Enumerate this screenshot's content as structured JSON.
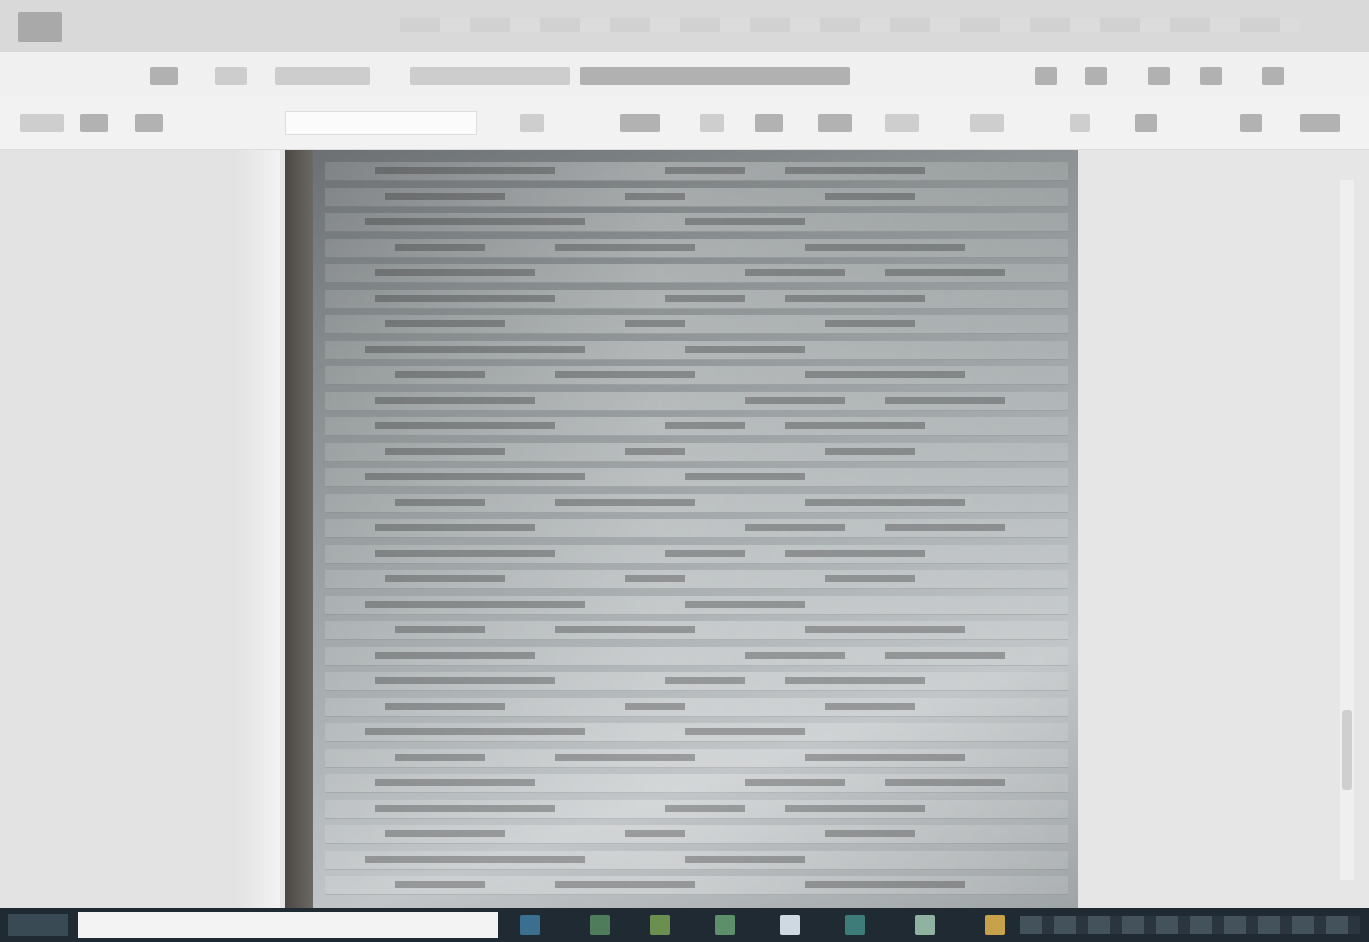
{
  "window": {
    "title": ""
  },
  "toolbar": {
    "search_placeholder": ""
  },
  "taskbar": {
    "search_placeholder": ""
  },
  "colors": {
    "titlebar": "#d9d9d9",
    "toolbar": "#f0f0f0",
    "viewer_background": "#e6e6e6",
    "taskbar": "#1f2a33"
  },
  "icons": {
    "app": "app-icon",
    "start": "start-icon",
    "search": "search-icon"
  }
}
